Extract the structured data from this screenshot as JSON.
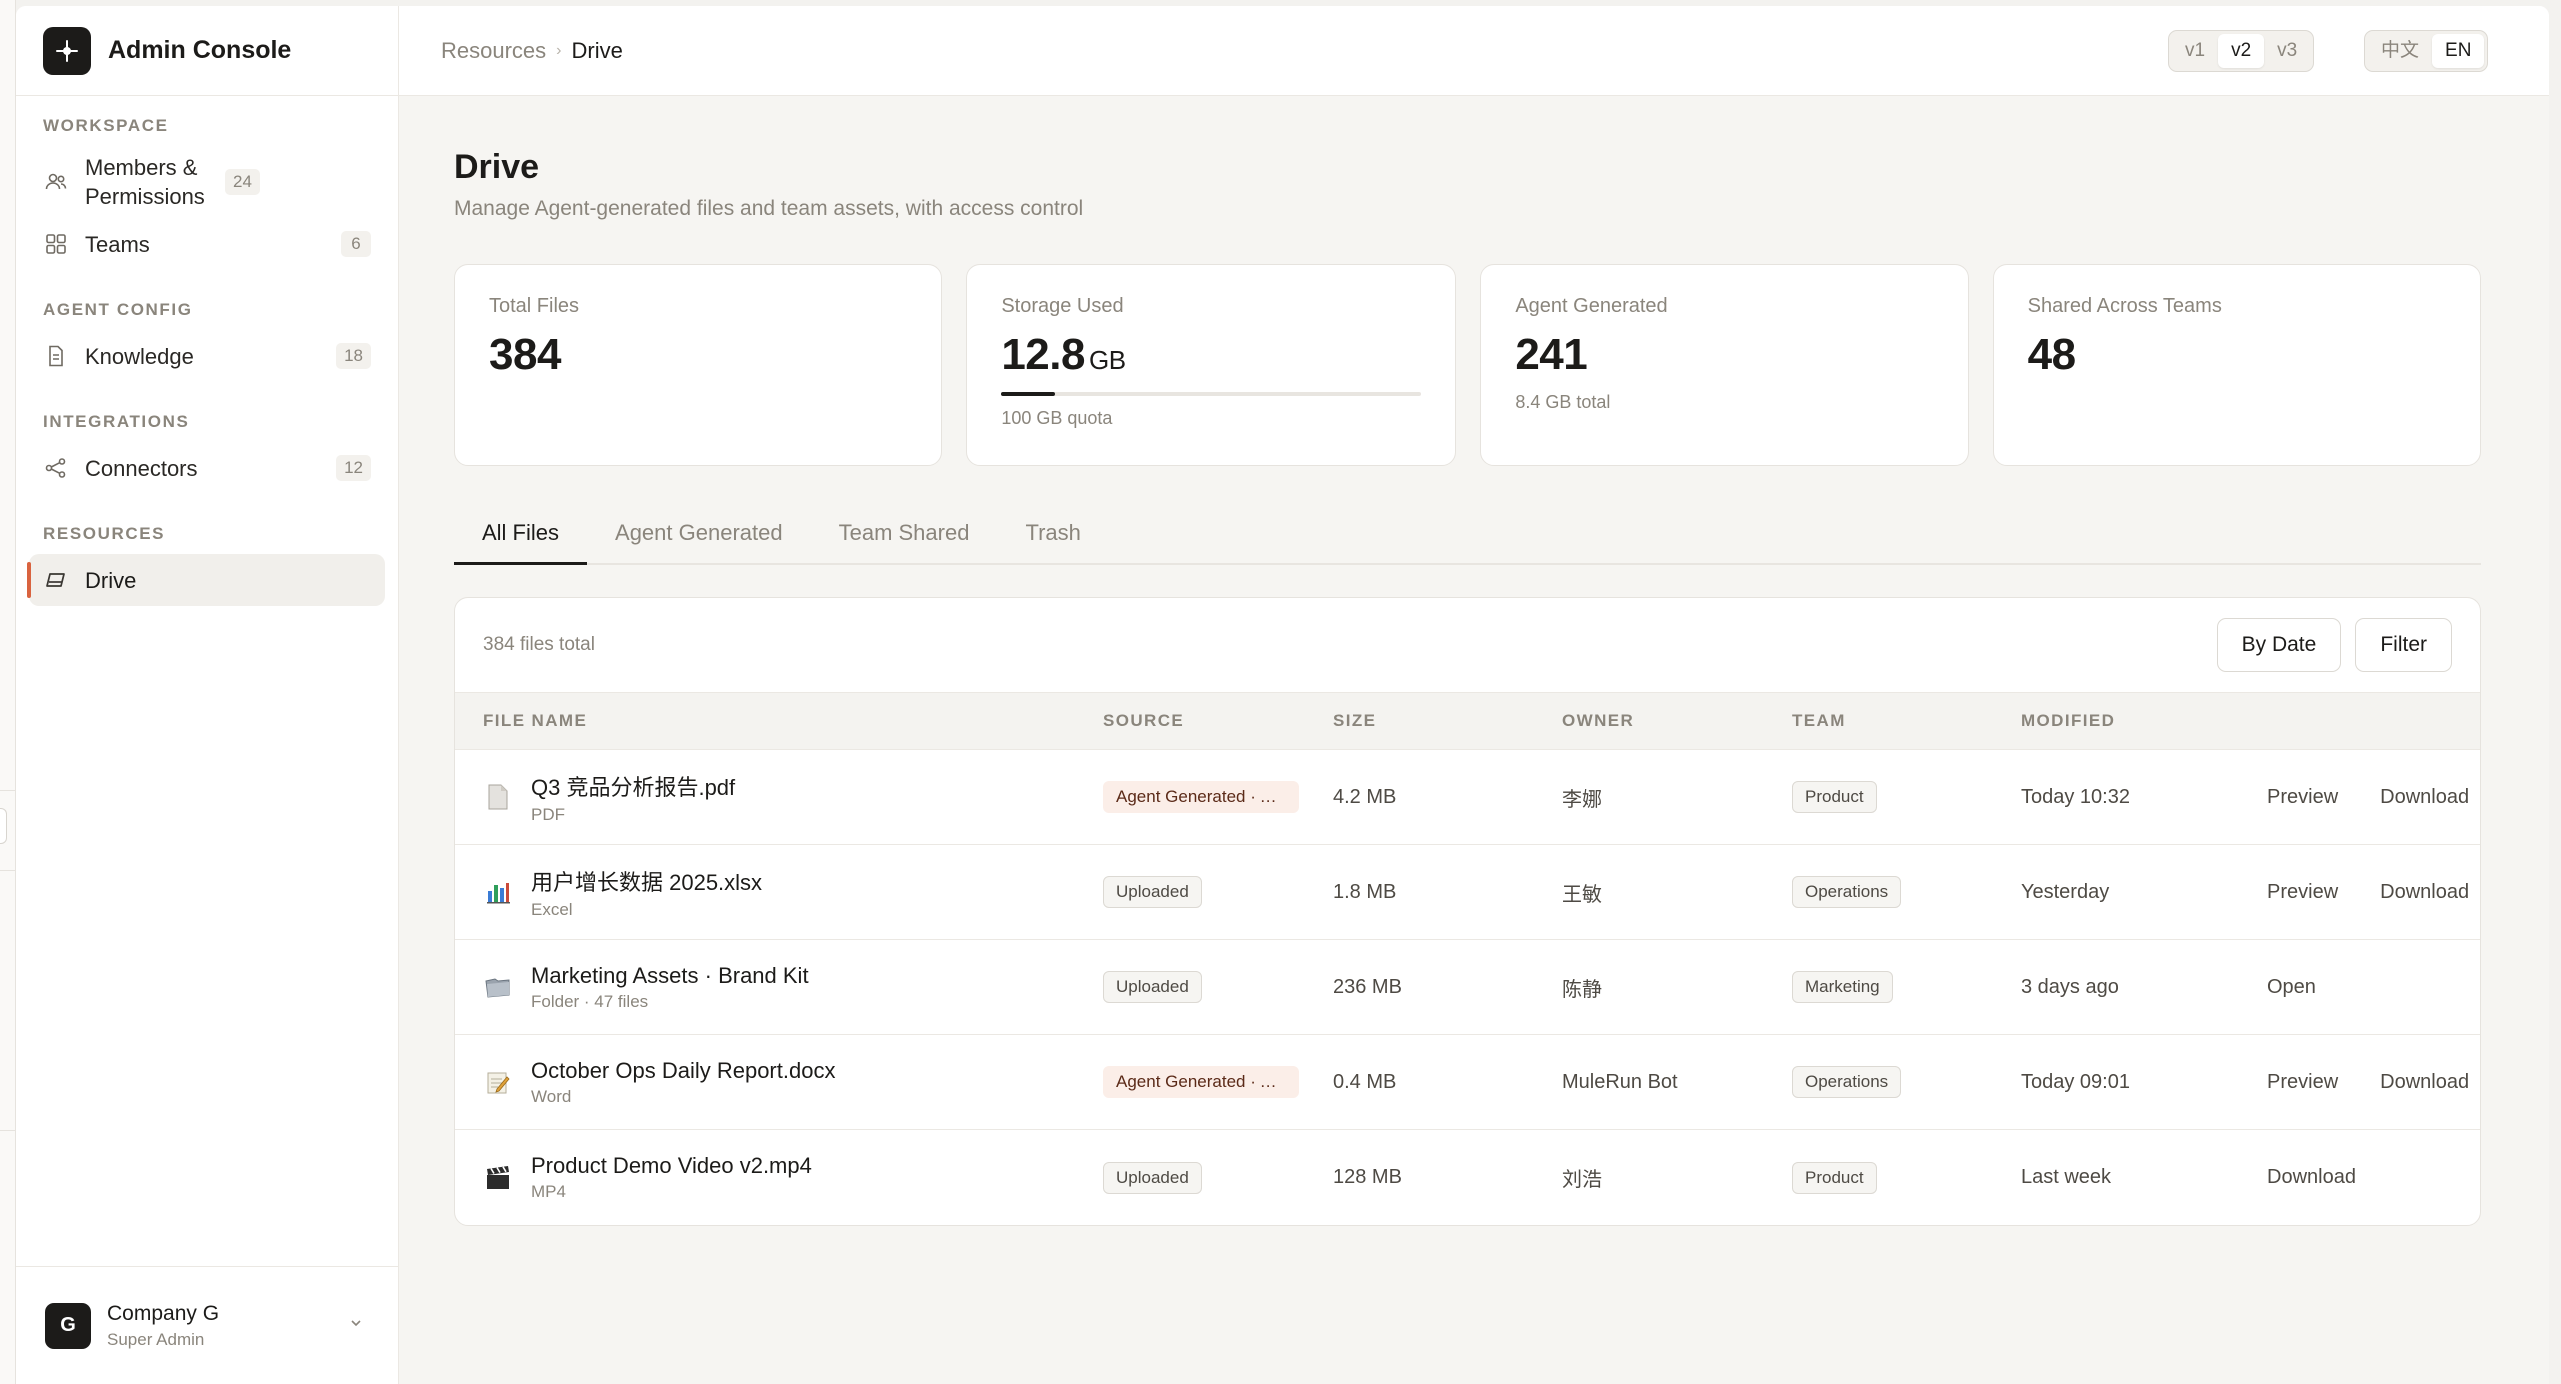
{
  "app": {
    "title": "Admin Console"
  },
  "sidebar": {
    "sections": [
      {
        "label": "WORKSPACE",
        "items": [
          {
            "label": "Members & Permissions",
            "count": "24",
            "icon": "users-icon"
          },
          {
            "label": "Teams",
            "count": "6",
            "icon": "grid-icon"
          }
        ]
      },
      {
        "label": "AGENT CONFIG",
        "items": [
          {
            "label": "Knowledge",
            "count": "18",
            "icon": "document-icon"
          }
        ]
      },
      {
        "label": "INTEGRATIONS",
        "items": [
          {
            "label": "Connectors",
            "count": "12",
            "icon": "share-nodes-icon"
          }
        ]
      },
      {
        "label": "RESOURCES",
        "items": [
          {
            "label": "Drive",
            "count": "",
            "icon": "drive-icon",
            "active": true
          }
        ]
      }
    ],
    "footer": {
      "avatar": "G",
      "name": "Company G",
      "role": "Super Admin"
    }
  },
  "topbar": {
    "breadcrumb": {
      "parent": "Resources",
      "current": "Drive"
    },
    "versions": [
      "v1",
      "v2",
      "v3"
    ],
    "active_version": "v2",
    "languages": [
      "中文",
      "EN"
    ],
    "active_language": "EN"
  },
  "page": {
    "title": "Drive",
    "subtitle": "Manage Agent-generated files and team assets, with access control"
  },
  "stats": {
    "total_files": {
      "label": "Total Files",
      "value": "384"
    },
    "storage": {
      "label": "Storage Used",
      "value": "12.8",
      "unit": "GB",
      "sub": "100 GB quota",
      "fraction": 0.128
    },
    "agent_generated": {
      "label": "Agent Generated",
      "value": "241",
      "sub": "8.4 GB total"
    },
    "shared": {
      "label": "Shared Across Teams",
      "value": "48"
    }
  },
  "tabs": [
    "All Files",
    "Agent Generated",
    "Team Shared",
    "Trash"
  ],
  "active_tab": "All Files",
  "table": {
    "count_text": "384 files total",
    "buttons": {
      "by_date": "By Date",
      "filter": "Filter"
    },
    "headers": [
      "FILE NAME",
      "SOURCE",
      "SIZE",
      "OWNER",
      "TEAM",
      "MODIFIED"
    ],
    "rows": [
      {
        "name": "Q3 竞品分析报告.pdf",
        "type": "PDF",
        "icon": "pdf-file-icon",
        "source": "Agent Generated · Auto",
        "source_kind": "agent",
        "size": "4.2 MB",
        "owner": "李娜",
        "team": "Product",
        "modified": "Today 10:32",
        "actions": [
          "Preview",
          "Download"
        ]
      },
      {
        "name": "用户增长数据 2025.xlsx",
        "type": "Excel",
        "icon": "spreadsheet-icon",
        "source": "Uploaded",
        "source_kind": "upload",
        "size": "1.8 MB",
        "owner": "王敏",
        "team": "Operations",
        "modified": "Yesterday",
        "actions": [
          "Preview",
          "Download"
        ]
      },
      {
        "name": "Marketing Assets · Brand Kit",
        "type": "Folder · 47 files",
        "icon": "folder-icon",
        "source": "Uploaded",
        "source_kind": "upload",
        "size": "236 MB",
        "owner": "陈静",
        "team": "Marketing",
        "modified": "3 days ago",
        "actions": [
          "Open"
        ]
      },
      {
        "name": "October Ops Daily Report.docx",
        "type": "Word",
        "icon": "word-doc-icon",
        "source": "Agent Generated · Auto",
        "source_kind": "agent",
        "size": "0.4 MB",
        "owner": "MuleRun Bot",
        "team": "Operations",
        "modified": "Today 09:01",
        "actions": [
          "Preview",
          "Download"
        ]
      },
      {
        "name": "Product Demo Video v2.mp4",
        "type": "MP4",
        "icon": "video-clapper-icon",
        "source": "Uploaded",
        "source_kind": "upload",
        "size": "128 MB",
        "owner": "刘浩",
        "team": "Product",
        "modified": "Last week",
        "actions": [
          "Download"
        ]
      }
    ]
  },
  "colors": {
    "accent": "#d9633f",
    "ink": "#1c1b19",
    "muted": "#8a857c",
    "agent_pill_bg": "#fbeee8"
  }
}
